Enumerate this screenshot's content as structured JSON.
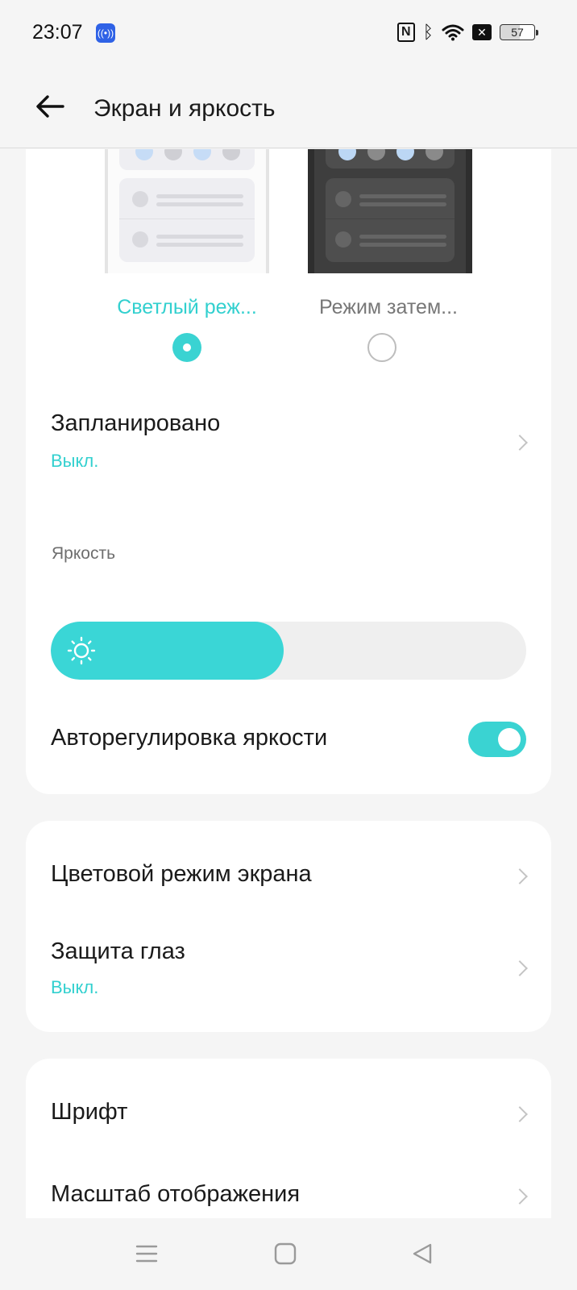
{
  "status_bar": {
    "time": "23:07",
    "notification_icon": "broadcast-icon",
    "icons": [
      "nfc-icon",
      "bluetooth-icon",
      "wifi-icon",
      "app-icon"
    ],
    "battery": "57"
  },
  "app_bar": {
    "back_icon": "arrow-left-icon",
    "title": "Экран и яркость"
  },
  "theme": {
    "options": [
      {
        "label": "Светлый реж...",
        "selected": true
      },
      {
        "label": "Режим затем...",
        "selected": false
      }
    ],
    "scheduled": {
      "label": "Запланировано",
      "value": "Выкл."
    }
  },
  "brightness": {
    "section_title": "Яркость",
    "level_fraction": 0.49,
    "auto_label": "Авторегулировка яркости",
    "auto_enabled": true
  },
  "display": {
    "color_mode_label": "Цветовой режим экрана",
    "eye_protection_label": "Защита глаз",
    "eye_protection_value": "Выкл."
  },
  "text": {
    "font_label": "Шрифт",
    "scale_label": "Масштаб отображения"
  },
  "nav_bar": {
    "buttons": [
      "menu-icon",
      "home-icon",
      "back-triangle-icon"
    ]
  },
  "colors": {
    "accent": "#3ad3d2",
    "background": "#f5f5f5",
    "card": "#ffffff"
  }
}
